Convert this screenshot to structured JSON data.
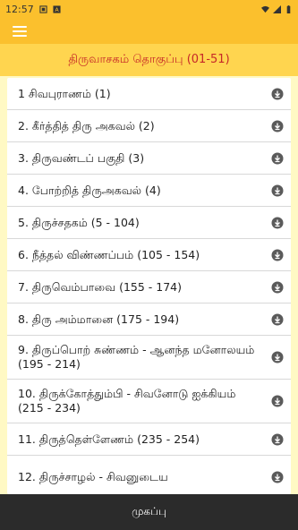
{
  "status_bar": {
    "time": "12:57",
    "left_icons": [
      "notification-icon",
      "a-icon"
    ],
    "right_icons": [
      "wifi-icon",
      "signal-icon",
      "battery-icon"
    ]
  },
  "toolbar": {
    "menu_icon": "hamburger-menu-icon"
  },
  "header": {
    "title": "திருவாசகம் தொகுப்பு (01-51)"
  },
  "list": {
    "items": [
      {
        "label": "1 சிவபுராணம் (1)"
      },
      {
        "label": "2. கீர்த்தித் திரு அகவல் (2)"
      },
      {
        "label": "3. திருவண்டப் பகுதி (3)"
      },
      {
        "label": "4. போற்றித் திருஅகவல் (4)"
      },
      {
        "label": "5. திருச்சதகம் (5 - 104)"
      },
      {
        "label": "6. நீத்தல் விண்ணப்பம் (105 - 154)"
      },
      {
        "label": "7. திருவெம்பாவை (155 - 174)"
      },
      {
        "label": "8. திரு அம்மானை (175 - 194)"
      },
      {
        "label": "9. திருப்பொற் சுண்ணம் - ஆனந்த மனோலயம் (195 - 214)"
      },
      {
        "label": "10. திருக்கோத்தும்பி - சிவனோடு ஐக்கியம் (215 - 234)"
      },
      {
        "label": "11. திருத்தெள்ளேணம் (235 - 254)"
      },
      {
        "label": "12. திருச்சாழல் - சிவனுடைய"
      }
    ],
    "item_icon": "download-icon"
  },
  "bottom_nav": {
    "label": "முகப்பு"
  },
  "colors": {
    "status_bar": "#fbc02d",
    "toolbar": "#fbc02d",
    "header_bg": "#ffd54f",
    "header_text": "#c62828",
    "page_bg": "#fff9c4",
    "bottom_bar": "#2b2b2b"
  }
}
